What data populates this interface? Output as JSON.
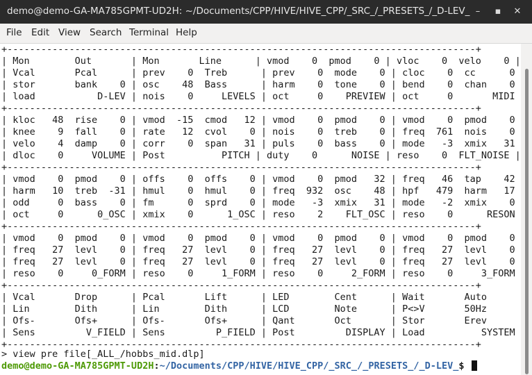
{
  "window": {
    "title": "demo@demo-GA-MA785GPMT-UD2H: ~/Documents/CPP/HIVE/HIVE_CPP/_SRC_/_PRESETS_/_D-LEV_",
    "minimize_glyph": "–",
    "maximize_glyph": "▪",
    "close_glyph": "✕"
  },
  "menu": {
    "file": "File",
    "edit": "Edit",
    "view": "View",
    "search": "Search",
    "terminal": "Terminal",
    "help": "Help"
  },
  "terminal": {
    "screen": "+-----------------------------------------------------------------------------------+\n| Mon        Out       | Mon       Line      | vmod    0  pmod    0 | vloc    0  velo    0 |\n| Vcal       Pcal      | prev    0  Treb      | prev    0  mode    0 | cloc    0  cc      0 |\n| stor       bank    0 | osc    48  Bass      | harm    0  tone    0 | bend    0  chan    0 |\n| load           D-LEV | nois    0     LEVELS | oct     0    PREVIEW | oct     0       MIDI |\n+-----------------------------------------------------------------------------------+\n| kloc   48  rise    0 | vmod  -15  cmod   12 | vmod    0  pmod    0 | vmod    0  pmod    0 |\n| knee    9  fall    0 | rate   12  cvol    0 | nois    0  treb    0 | freq  761  nois    0 |\n| velo    4  damp    0 | corr    0  span   31 | puls    0  bass    0 | mode   -3  xmix   31 |\n| dloc    0     VOLUME | Post          PITCH | duty    0      NOISE | reso    0  FLT_NOISE |\n+-----------------------------------------------------------------------------------+\n| vmod    0  pmod    0 | offs    0  offs    0 | vmod    0  pmod   32 | freq   46  tap    42 |\n| harm   10  treb  -31 | hmul    0  hmul    0 | freq  932  osc    48 | hpf   479  harm   17 |\n| odd     0  bass    0 | fm      0  sprd    0 | mode   -3  xmix   31 | mode   -2  xmix    0 |\n| oct     0      0_OSC | xmix    0      1_OSC | reso    2    FLT_OSC | reso    0      RESON |\n+-----------------------------------------------------------------------------------+\n| vmod    0  pmod    0 | vmod    0  pmod    0 | vmod    0  pmod    0 | vmod    0  pmod    0 |\n| freq   27  levl    0 | freq   27  levl    0 | freq   27  levl    0 | freq   27  levl    0 |\n| freq   27  levl    0 | freq   27  levl    0 | freq   27  levl    0 | freq   27  levl    0 |\n| reso    0     0_FORM | reso    0     1_FORM | reso    0     2_FORM | reso    0     3_FORM |\n+-----------------------------------------------------------------------------------+\n| Vcal       Drop      | Pcal       Lift      | LED        Cent      | Wait       Auto      |\n| Lin        Dith      | Lin        Dith      | LCD        Note      | P<>V       50Hz      |\n| Ofs-       Ofs+      | Ofs-       Ofs+      | Qant       Oct       | Stor       Erev      |\n| Sens         V_FIELD | Sens         P_FIELD | Post         DISPLAY | Load          SYSTEM |\n+-----------------------------------------------------------------------------------+",
    "command": "> view pre file[_ALL_/hobbs_mid.dlp]",
    "prompt_user": "demo@demo-GA-MA785GPMT-UD2H",
    "prompt_sep": ":",
    "prompt_path": "~/Documents/CPP/HIVE/HIVE_CPP/_SRC_/_PRESETS_/_D-LEV_",
    "prompt_symbol": "$ "
  }
}
